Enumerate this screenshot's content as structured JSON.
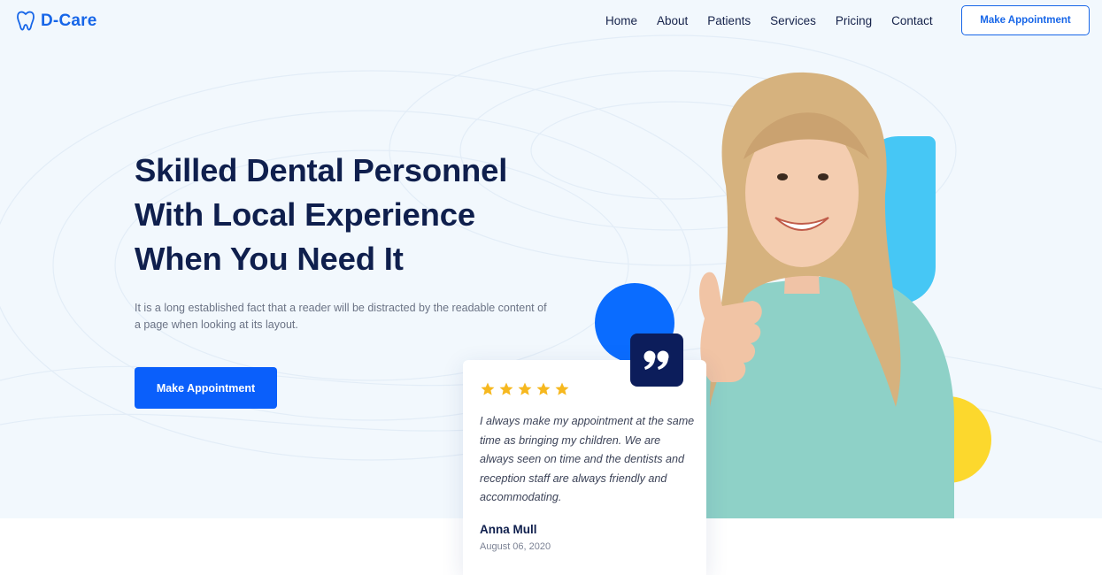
{
  "header": {
    "brand": "D-Care",
    "nav": [
      "Home",
      "About",
      "Patients",
      "Services",
      "Pricing",
      "Contact"
    ],
    "cta": "Make Appointment"
  },
  "hero": {
    "headline": [
      "Skilled Dental Personnel",
      "With Local Experience",
      "When You Need It"
    ],
    "description": "It is a long established fact that a reader will be distracted by the readable content of a page when looking at its layout.",
    "cta": "Make Appointment"
  },
  "testimonial": {
    "rating": 5,
    "quote": "I always make my appointment at the same time as bringing my children. We are always seen on time and the dentists and reception staff are always friendly and accommodating.",
    "author": "Anna Mull",
    "date": "August 06, 2020"
  },
  "colors": {
    "brand": "#1766e8",
    "primary_button": "#0a5ffb",
    "navy": "#0f1f4d",
    "cyan_accent": "#46c7f5",
    "yellow_accent": "#fcd82d",
    "star": "#f6b81f"
  },
  "icons": {
    "logo": "tooth-icon",
    "quote": "quote-icon",
    "rating": "star-icon"
  }
}
